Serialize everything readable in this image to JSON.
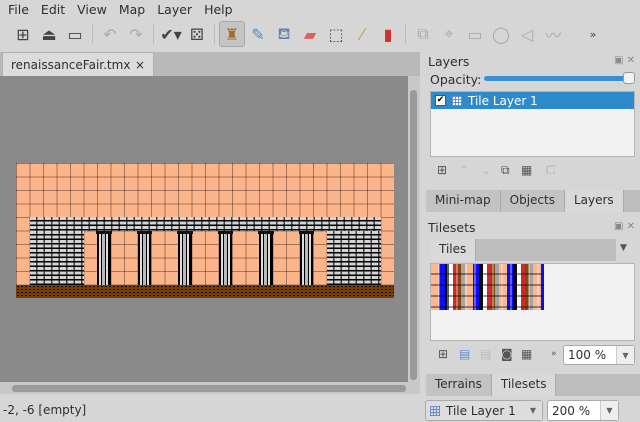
{
  "menu": [
    "File",
    "Edit",
    "View",
    "Map",
    "Layer",
    "Help"
  ],
  "toolbar": {
    "icons": [
      "new-icon",
      "open-icon",
      "save-icon",
      "undo-icon",
      "redo-icon",
      "commands-icon",
      "random-icon",
      "stamp-brush-icon",
      "terrain-brush-icon",
      "bucket-fill-icon",
      "eraser-icon",
      "rect-select-icon",
      "magic-wand-icon",
      "select-same-tile-icon",
      "select-objects-icon",
      "edit-polygons-icon",
      "insert-rectangle-icon",
      "insert-ellipse-icon",
      "insert-polygon-icon",
      "insert-polyline-icon"
    ],
    "overflow": "»"
  },
  "document": {
    "tab_label": "renaissanceFair.tmx",
    "close": "×"
  },
  "status": {
    "coords": "-2, -6 [empty]"
  },
  "layers_panel": {
    "title": "Layers",
    "opacity_label": "Opacity:",
    "opacity": 1.0,
    "layers": [
      {
        "name": "Tile Layer 1",
        "visible": true,
        "selected": true
      }
    ]
  },
  "top_tabs": [
    "Mini-map",
    "Objects",
    "Layers"
  ],
  "tilesets_panel": {
    "title": "Tilesets",
    "tileset_tab": "Tiles",
    "zoom": "100 %",
    "more": "»"
  },
  "bottom_tabs": [
    "Terrains",
    "Tilesets"
  ],
  "bottom_bar": {
    "layer": "Tile Layer 1",
    "zoom": "200 %"
  },
  "colors": {
    "sky": "#fcb48a",
    "dirt": "#7a3d00",
    "selection": "#2f8acb"
  }
}
